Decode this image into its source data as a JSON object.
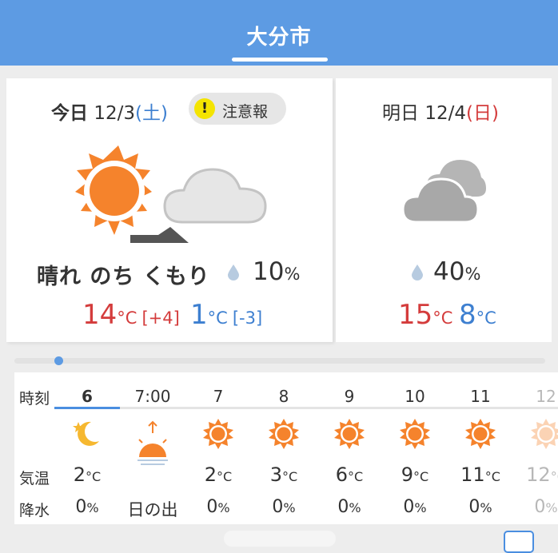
{
  "header": {
    "title": "大分市"
  },
  "today": {
    "label": "今日",
    "date": "12/3",
    "dow": "(土)",
    "warning": {
      "icon_text": "!",
      "label": "注意報"
    },
    "icon": "sun-then-cloud-icon",
    "condition": "晴れ のち くもり",
    "rain_chance": "10",
    "rain_unit": "%",
    "high": "14",
    "high_diff": "[+4]",
    "low": "1",
    "low_diff": "[-3]",
    "temp_unit": "°C"
  },
  "tomorrow": {
    "label": "明日",
    "date": "12/4",
    "dow": "(日)",
    "icon": "cloudy-icon",
    "rain_chance": "40",
    "rain_unit": "%",
    "high": "15",
    "low": "8",
    "temp_unit": "°C"
  },
  "hourly": {
    "labels": {
      "time": "時刻",
      "temp": "気温",
      "rain": "降水"
    },
    "hours": [
      {
        "time": "6",
        "icon": "moon-icon",
        "temp": "2",
        "rain": "0"
      },
      {
        "time": "7:00",
        "icon": "sunrise-icon",
        "event": "日の出"
      },
      {
        "time": "7",
        "icon": "sun-icon",
        "temp": "2",
        "rain": "0"
      },
      {
        "time": "8",
        "icon": "sun-icon",
        "temp": "3",
        "rain": "0"
      },
      {
        "time": "9",
        "icon": "sun-icon",
        "temp": "6",
        "rain": "0"
      },
      {
        "time": "10",
        "icon": "sun-icon",
        "temp": "9",
        "rain": "0"
      },
      {
        "time": "11",
        "icon": "sun-icon",
        "temp": "11",
        "rain": "0"
      },
      {
        "time": "12",
        "icon": "sun-icon",
        "temp": "12",
        "rain": "0"
      }
    ]
  },
  "colors": {
    "header_bg": "#5d9be3",
    "high_temp": "#d43c3c",
    "low_temp": "#3d7fd0",
    "sun": "#f5832c",
    "cloud": "#a8a8a8",
    "warning": "#f4e400"
  }
}
